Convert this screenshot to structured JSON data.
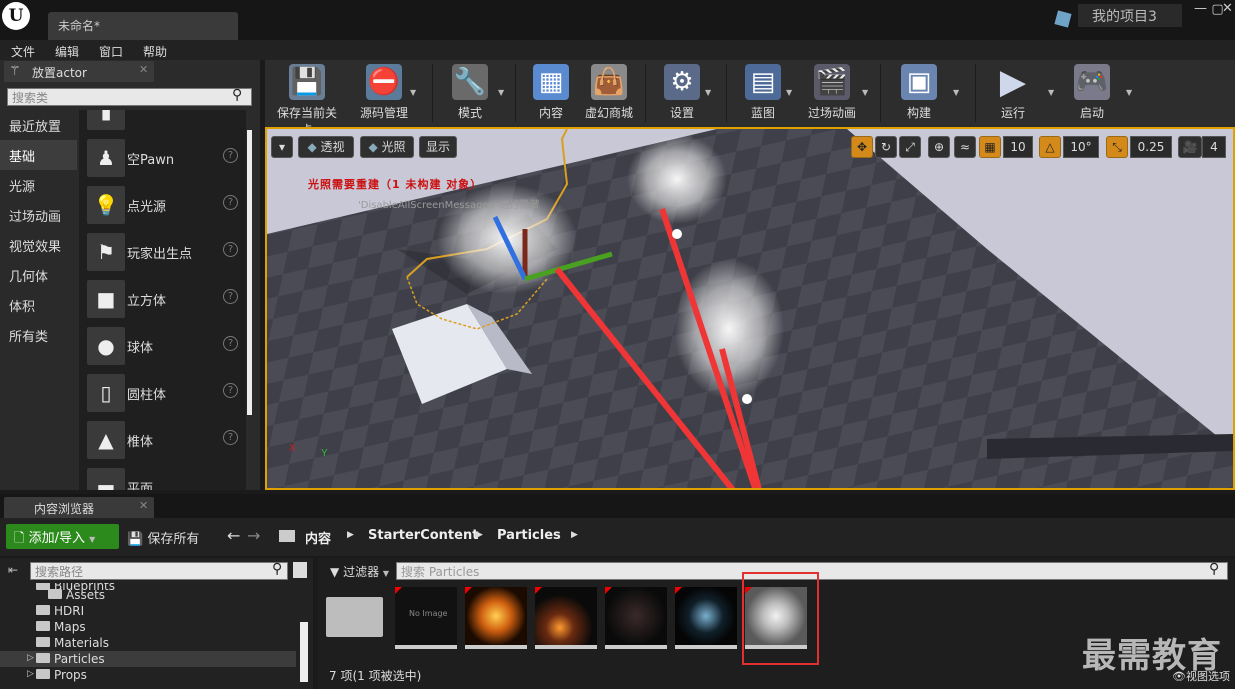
{
  "title_bar": {
    "doc_tab": "未命名*",
    "project": "我的项目3",
    "logo": "U"
  },
  "menu": [
    "文件",
    "编辑",
    "窗口",
    "帮助"
  ],
  "place_panel": {
    "tab": "放置actor",
    "search_placeholder": "搜索类",
    "categories": [
      "最近放置",
      "基础",
      "光源",
      "过场动画",
      "视觉效果",
      "几何体",
      "体积",
      "所有类"
    ],
    "items": [
      "空Pawn",
      "点光源",
      "玩家出生点",
      "立方体",
      "球体",
      "圆柱体",
      "椎体",
      "平面"
    ]
  },
  "toolbar": [
    "保存当前关卡",
    "源码管理",
    "模式",
    "内容",
    "虚幻商城",
    "设置",
    "蓝图",
    "过场动画",
    "构建",
    "运行",
    "启动"
  ],
  "viewport": {
    "perspective": "透视",
    "lit": "光照",
    "show": "显示",
    "grid_snap": "10",
    "rot_snap": "10°",
    "scale_snap": "0.25",
    "cam_speed": "4",
    "warning": "光照需要重建（1 未构建 对象）",
    "message": "'DisableAllScreenMessages' 进行隐藏"
  },
  "content_browser": {
    "tab": "内容浏览器",
    "add_import": "添加/导入",
    "save_all": "保存所有",
    "breadcrumb": [
      "内容",
      "StarterContent",
      "Particles"
    ],
    "path_search_placeholder": "搜索路径",
    "filter": "过滤器",
    "asset_search_placeholder": "搜索 Particles",
    "tree": [
      "Blueprints",
      "Assets",
      "HDRI",
      "Maps",
      "Materials",
      "Particles",
      "Props"
    ],
    "status": "7 项(1 项被选中)",
    "view_options": "视图选项",
    "no_image": "No Image"
  },
  "watermark": "最需教育"
}
